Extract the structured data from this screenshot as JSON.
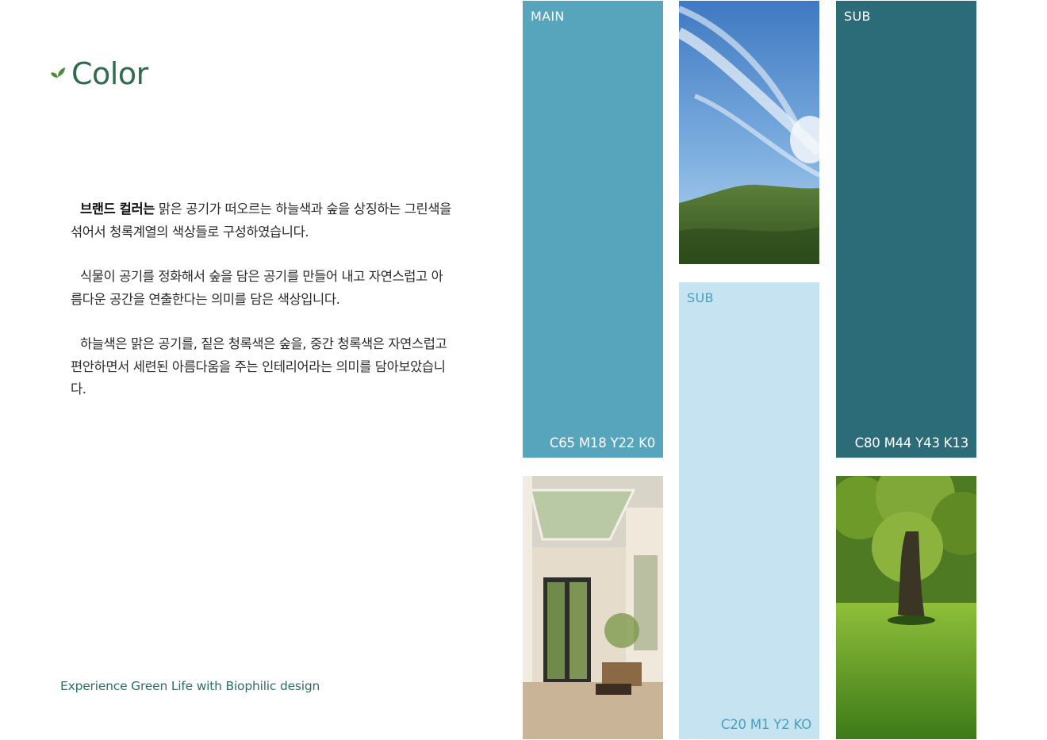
{
  "title": "Color",
  "description": {
    "p1_bold": "브랜드 컬러는",
    "p1_rest": " 맑은 공기가 떠오르는 하늘색과 숲을 상징하는 그린색을  섞어서 청록계열의 색상들로 구성하였습니다.",
    "p2": "식물이 공기를 정화해서 숲을 담은 공기를 만들어 내고 자연스럽고 아름다운 공간을 연출한다는 의미를 담은 색상입니다.",
    "p3": "하늘색은 맑은 공기를,  짙은 청록색은 숲을, 중간 청록색은 자연스럽고 편안하면서 세련된 아름다움을 주는 인테리어라는 의미를 담아보았습니다."
  },
  "tagline": "Experience Green Life with Biophilic design",
  "swatches": {
    "main": {
      "label": "MAIN",
      "code": "C65 M18 Y22 K0",
      "color": "#57a5bd",
      "label_color": "#ffffff"
    },
    "sub_light": {
      "label": "SUB",
      "code": "C20 M1 Y2 KO",
      "color": "#c6e3f1",
      "label_color": "#4a9fb9"
    },
    "sub_dark": {
      "label": "SUB",
      "code": "C80 M44 Y43 K13",
      "color": "#2c6c79",
      "label_color": "#ffffff"
    }
  },
  "icons": [
    "leaf-icon"
  ]
}
